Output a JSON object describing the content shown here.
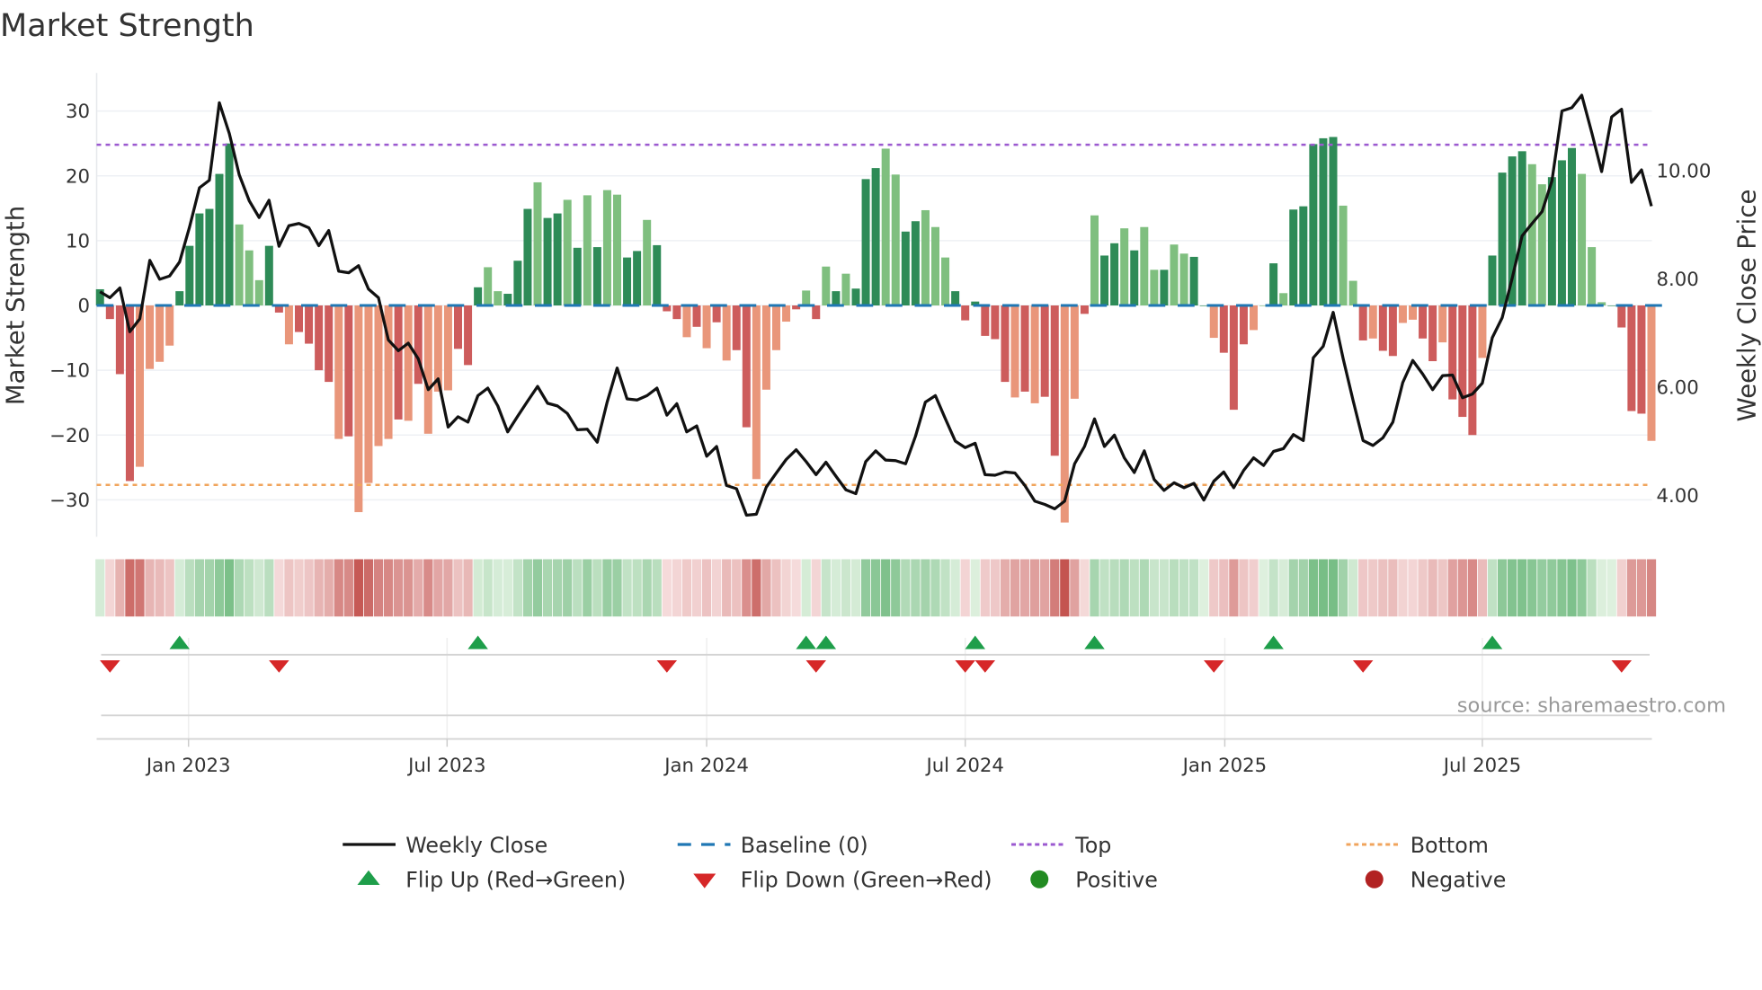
{
  "title": "Market Strength",
  "source": "source: sharemaestro.com",
  "legend": {
    "weekly_close": "Weekly Close",
    "baseline": "Baseline (0)",
    "top": "Top",
    "bottom": "Bottom",
    "flip_up": "Flip Up (Red→Green)",
    "flip_down": "Flip Down (Green→Red)",
    "positive": "Positive",
    "negative": "Negative"
  },
  "colors": {
    "strong_green": "#2e8b57",
    "weak_green": "#7fbf7f",
    "strong_red": "#cd5c5c",
    "weak_red": "#e9967a",
    "baseline": "#1f77b4",
    "top": "#9b59d0",
    "bottom": "#f0a45c",
    "line": "#111111",
    "flip_up": "#1e9e4a",
    "flip_down": "#d62728",
    "positive": "#228b22",
    "negative": "#b22222"
  },
  "chart_data": {
    "type": "bar",
    "title": "Market Strength",
    "ylabel": "Market Strength",
    "y2label": "Weekly Close Price",
    "ylim": [
      -36,
      36
    ],
    "y2lim": [
      3.3,
      11.8
    ],
    "yticks": [
      "30",
      "20",
      "10",
      "0",
      "−10",
      "−20",
      "−30"
    ],
    "ytick_values": [
      30,
      20,
      10,
      0,
      -10,
      -20,
      -30
    ],
    "y2ticks": [
      "10.00",
      "8.00",
      "6.00",
      "4.00"
    ],
    "y2tick_values": [
      10,
      8,
      6,
      4
    ],
    "x_unit": "week index (weekly bars, first ≈ end of Oct 2022)",
    "xticks": [
      {
        "label": "Jan 2023",
        "week": 8.9
      },
      {
        "label": "Jul 2023",
        "week": 34.9
      },
      {
        "label": "Jan 2024",
        "week": 61
      },
      {
        "label": "Jul 2024",
        "week": 87
      },
      {
        "label": "Jan 2025",
        "week": 113.1
      },
      {
        "label": "Jul 2025",
        "week": 139
      }
    ],
    "top_level": 24.8,
    "bottom_level": -27.7,
    "strength": [
      2.5,
      -2.1,
      -10.6,
      -27.1,
      -24.9,
      -9.8,
      -8.7,
      -6.2,
      2.2,
      9.2,
      14.2,
      14.9,
      20.3,
      25.0,
      12.5,
      8.5,
      3.9,
      9.2,
      -1.1,
      -6.0,
      -4.1,
      -5.9,
      -10.0,
      -11.8,
      -20.6,
      -20.2,
      -31.9,
      -27.4,
      -21.7,
      -20.6,
      -17.6,
      -17.8,
      -12.1,
      -19.8,
      -13.3,
      -13.1,
      -6.7,
      -9.2,
      2.8,
      5.9,
      2.2,
      1.8,
      6.9,
      14.9,
      19.0,
      13.5,
      14.2,
      16.3,
      8.9,
      17.0,
      9.0,
      17.8,
      17.1,
      7.4,
      8.4,
      13.2,
      9.3,
      -0.9,
      -2.1,
      -4.9,
      -3.3,
      -6.6,
      -2.6,
      -8.5,
      -6.9,
      -18.8,
      -26.8,
      -13.0,
      -6.9,
      -2.5,
      -0.6,
      2.3,
      -2.1,
      6.0,
      2.2,
      4.9,
      2.6,
      19.5,
      21.2,
      24.2,
      20.2,
      11.4,
      13.0,
      14.7,
      12.1,
      7.4,
      2.2,
      -2.3,
      0.6,
      -4.7,
      -5.2,
      -11.8,
      -14.2,
      -13.3,
      -15.1,
      -14.1,
      -23.2,
      -33.5,
      -14.4,
      -1.3,
      13.9,
      7.7,
      9.6,
      11.9,
      8.5,
      12.1,
      5.5,
      5.5,
      9.4,
      8.0,
      7.5,
      0,
      -5.0,
      -7.3,
      -16.1,
      -6.0,
      -3.8,
      0,
      6.5,
      1.9,
      14.8,
      15.3,
      24.9,
      25.8,
      26.0,
      15.4,
      3.8,
      -5.4,
      -5.1,
      -7.0,
      -7.8,
      -2.7,
      -2.2,
      -5.1,
      -8.6,
      -5.7,
      -14.5,
      -17.2,
      -20.0,
      -8.1,
      7.7,
      20.5,
      23.0,
      23.8,
      21.8,
      18.7,
      19.8,
      22.4,
      24.3,
      20.3,
      9.0,
      0.5,
      0,
      -3.4,
      -16.3,
      -16.7,
      -20.9
    ],
    "strength_shade": "SSSSWWWWSSSSSSWWWSSWSSSSWSWWWWSWSWWWSSSWWSSSWSSWSWSWWSSWSSSWSWSWSSWWWWSWSWSWSSSWWSSWWWSSSSSSWSWSSWWSWSSWSWWSWWSSWSSSWWSWSSSSSWWSWSSWWSSWSSSWSSSSWWSSSWWWSSSS",
    "weekly_close": [
      7.76,
      7.65,
      7.83,
      7.02,
      7.26,
      8.34,
      7.99,
      8.05,
      8.31,
      8.95,
      9.68,
      9.82,
      11.25,
      10.68,
      9.92,
      9.44,
      9.13,
      9.45,
      8.6,
      8.98,
      9.02,
      8.94,
      8.61,
      8.89,
      8.14,
      8.11,
      8.24,
      7.81,
      7.65,
      6.87,
      6.67,
      6.81,
      6.52,
      5.95,
      6.15,
      5.26,
      5.45,
      5.35,
      5.84,
      5.98,
      5.65,
      5.17,
      5.46,
      5.74,
      6.01,
      5.7,
      5.65,
      5.51,
      5.21,
      5.22,
      4.98,
      5.72,
      6.35,
      5.78,
      5.76,
      5.84,
      5.98,
      5.48,
      5.69,
      5.17,
      5.28,
      4.72,
      4.9,
      4.18,
      4.12,
      3.63,
      3.65,
      4.15,
      4.41,
      4.66,
      4.84,
      4.62,
      4.38,
      4.61,
      4.35,
      4.1,
      4.03,
      4.62,
      4.82,
      4.65,
      4.64,
      4.58,
      5.09,
      5.72,
      5.84,
      5.41,
      5.0,
      4.88,
      4.96,
      4.38,
      4.37,
      4.43,
      4.41,
      4.18,
      3.89,
      3.83,
      3.75,
      3.89,
      4.58,
      4.9,
      5.41,
      4.9,
      5.11,
      4.69,
      4.42,
      4.82,
      4.29,
      4.09,
      4.23,
      4.14,
      4.22,
      3.91,
      4.26,
      4.43,
      4.14,
      4.46,
      4.69,
      4.55,
      4.81,
      4.86,
      5.12,
      5.01,
      6.54,
      6.75,
      7.38,
      6.52,
      5.75,
      5.01,
      4.92,
      5.06,
      5.35,
      6.08,
      6.49,
      6.24,
      5.95,
      6.21,
      6.22,
      5.8,
      5.87,
      6.07,
      6.91,
      7.28,
      8.01,
      8.79,
      9.02,
      9.24,
      9.81,
      11.1,
      11.16,
      11.39,
      10.7,
      9.98,
      10.99,
      11.13,
      9.78,
      10.01,
      9.34
    ],
    "flip_up_weeks": [
      8,
      38,
      71,
      73,
      88,
      100,
      118,
      140
    ],
    "flip_down_weeks": [
      1,
      18,
      57,
      72,
      87,
      89,
      112,
      127,
      153
    ],
    "legend_position": "bottom"
  }
}
